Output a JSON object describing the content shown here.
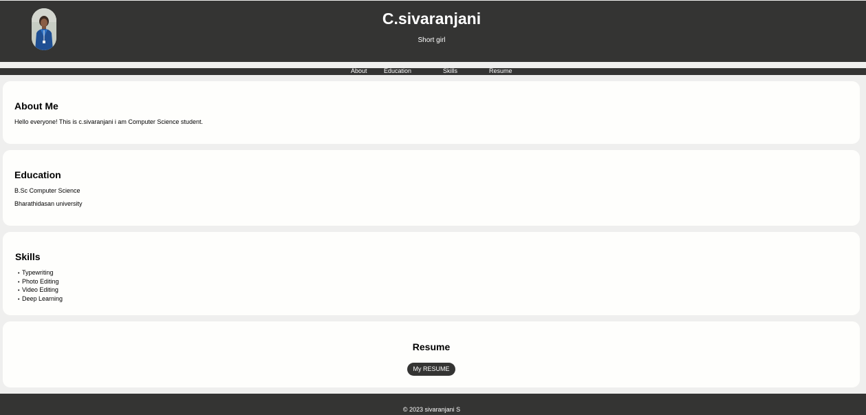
{
  "header": {
    "name": "C.sivaranjani",
    "tagline": "Short girl",
    "avatar_icon": "profile-photo"
  },
  "nav": {
    "items": [
      {
        "label": "About"
      },
      {
        "label": "Education"
      },
      {
        "label": "Skills"
      },
      {
        "label": "Resume"
      }
    ]
  },
  "about": {
    "heading": "About Me",
    "text": "Hello everyone! This is c.sivaranjani i am Computer Science student."
  },
  "education": {
    "heading": "Education",
    "degree": "B.Sc Computer Science",
    "university": "Bharathidasan university"
  },
  "skills": {
    "heading": "Skills",
    "items": [
      "Typewriting",
      "Photo Editing",
      "Video Editing",
      "Deep Learning"
    ]
  },
  "resume": {
    "heading": "Resume",
    "button_label": "My RESUME"
  },
  "footer": {
    "copyright": "© 2023 sivaranjani S"
  },
  "colors": {
    "dark": "#343433",
    "page_bg": "#efefee",
    "card_bg": "#fefefc",
    "text_light": "#ffffff"
  }
}
